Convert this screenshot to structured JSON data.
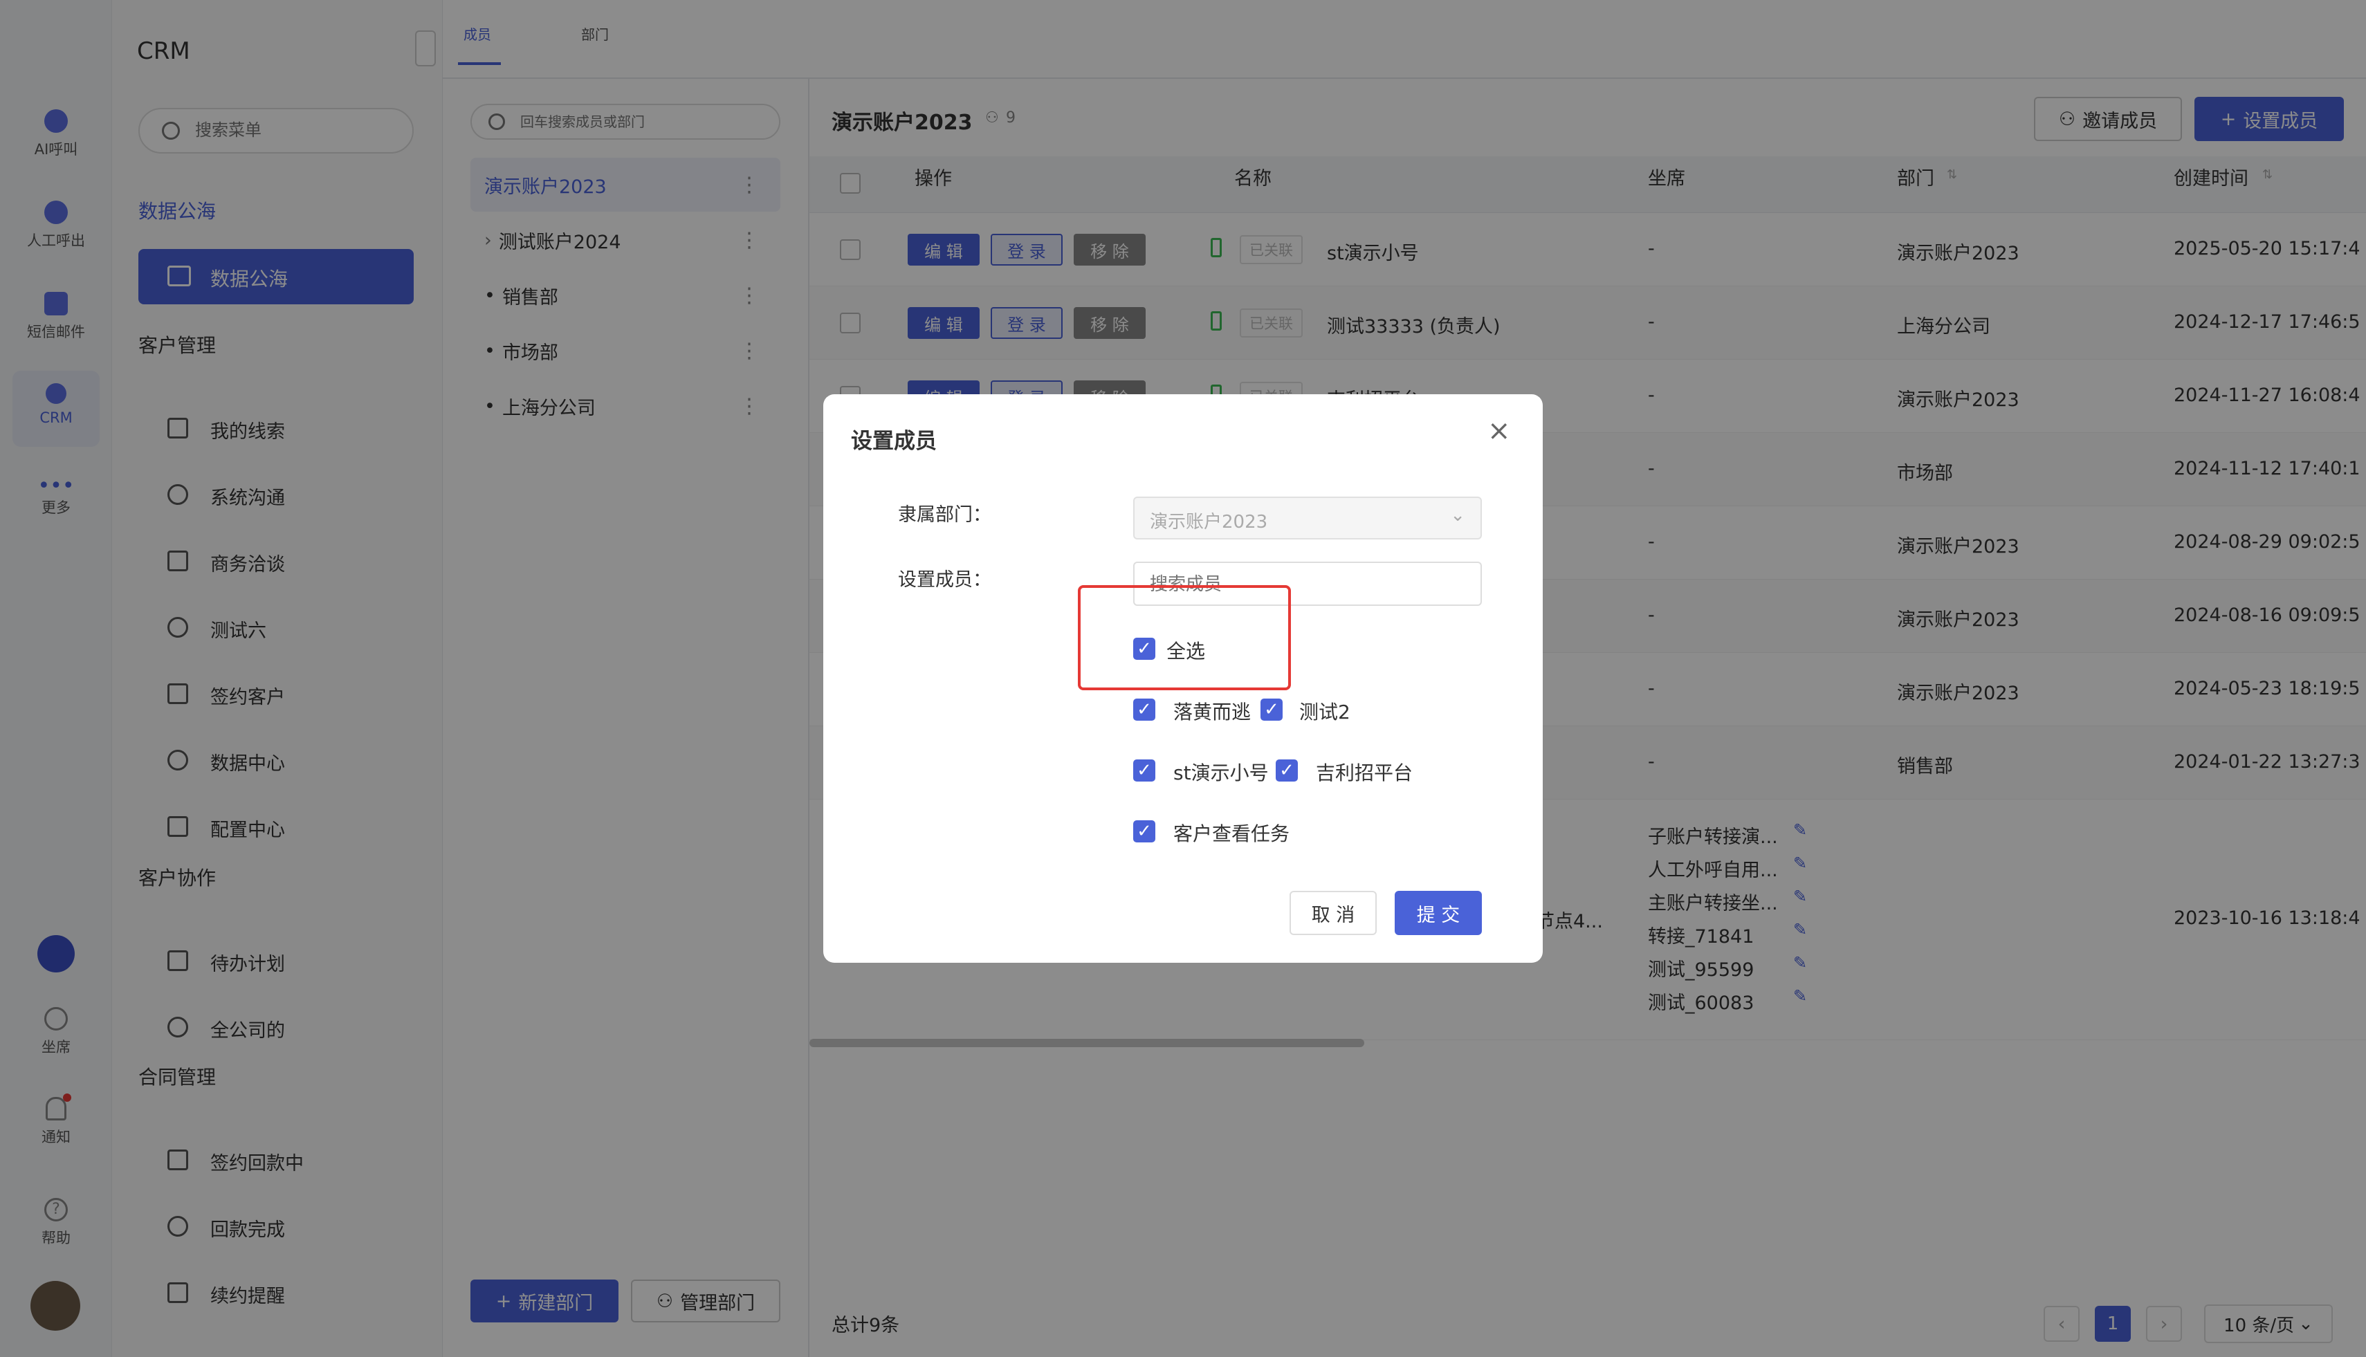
{
  "rail": {
    "items": [
      {
        "label": "AI呼叫"
      },
      {
        "label": "人工呼出"
      },
      {
        "label": "短信邮件"
      },
      {
        "label": "CRM"
      },
      {
        "label": "更多"
      },
      {
        "label": "坐席"
      },
      {
        "label": "通知"
      },
      {
        "label": "帮助"
      }
    ]
  },
  "menu": {
    "title": "CRM",
    "search_placeholder": "搜索菜单",
    "group_data": "数据公海",
    "active_item": "数据公海",
    "group_customer": "客户管理",
    "customer_items": [
      "我的线索",
      "系统沟通",
      "商务洽谈",
      "测试六",
      "签约客户",
      "数据中心",
      "配置中心"
    ],
    "group_collab": "客户协作",
    "collab_items": [
      "待办计划",
      "全公司的"
    ],
    "group_contract": "合同管理",
    "contract_items": [
      "签约回款中",
      "回款完成",
      "续约提醒"
    ]
  },
  "tabs": {
    "members": "成员",
    "departments": "部门"
  },
  "tree": {
    "search_placeholder": "回车搜索成员或部门",
    "nodes": [
      "演示账户2023",
      "测试账户2024",
      "销售部",
      "市场部",
      "上海分公司"
    ],
    "new_dept": "新建部门",
    "manage_dept": "管理部门"
  },
  "content": {
    "title": "演示账户2023",
    "member_count": "9",
    "invite_btn": "邀请成员",
    "set_btn": "设置成员",
    "columns": {
      "op": "操作",
      "name": "名称",
      "seat": "坐席",
      "dept": "部门",
      "created": "创建时间"
    },
    "op_labels": {
      "edit": "编 辑",
      "login": "登 录",
      "remove": "移 除"
    },
    "linked_tag": "已关联",
    "rows": [
      {
        "name": "st演示小号",
        "seat": "-",
        "dept": "演示账户2023",
        "created": "2025-05-20 15:17:4"
      },
      {
        "name": "测试33333 (负责人)",
        "seat": "-",
        "dept": "上海分公司",
        "created": "2024-12-17 17:46:5"
      },
      {
        "name": "吉利招平台",
        "seat": "-",
        "dept": "演示账户2023",
        "created": "2024-11-27 16:08:4"
      },
      {
        "name": "",
        "seat": "-",
        "dept": "市场部",
        "created": "2024-11-12 17:40:1"
      },
      {
        "name": "",
        "seat": "-",
        "dept": "演示账户2023",
        "created": "2024-08-29 09:02:5"
      },
      {
        "name": "",
        "seat": "-",
        "dept": "演示账户2023",
        "created": "2024-08-16 09:09:5"
      },
      {
        "name": "",
        "seat": "-",
        "dept": "演示账户2023",
        "created": "2024-05-23 18:19:5"
      },
      {
        "name": "",
        "seat": "-",
        "dept": "销售部",
        "created": "2024-01-22 13:27:3"
      }
    ],
    "last_row": {
      "name_tail": "节点4...",
      "seats": [
        "子账户转接演...",
        "人工外呼自用...",
        "主账户转接坐...",
        "转接_71841",
        "测试_95599",
        "测试_60083"
      ],
      "created": "2023-10-16 13:18:4"
    },
    "total": "总计9条",
    "page": "1",
    "page_size": "10 条/页"
  },
  "dialog": {
    "title": "设置成员",
    "dept_label": "隶属部门：",
    "dept_value": "演示账户2023",
    "member_label": "设置成员：",
    "search_placeholder": "搜索成员",
    "select_all": "全选",
    "options": [
      "落黄而逃",
      "测试2",
      "st演示小号",
      "吉利招平台",
      "客户查看任务"
    ],
    "cancel": "取 消",
    "submit": "提 交"
  },
  "colors": {
    "primary": "#4a62d8",
    "highlight": "#e53935"
  }
}
